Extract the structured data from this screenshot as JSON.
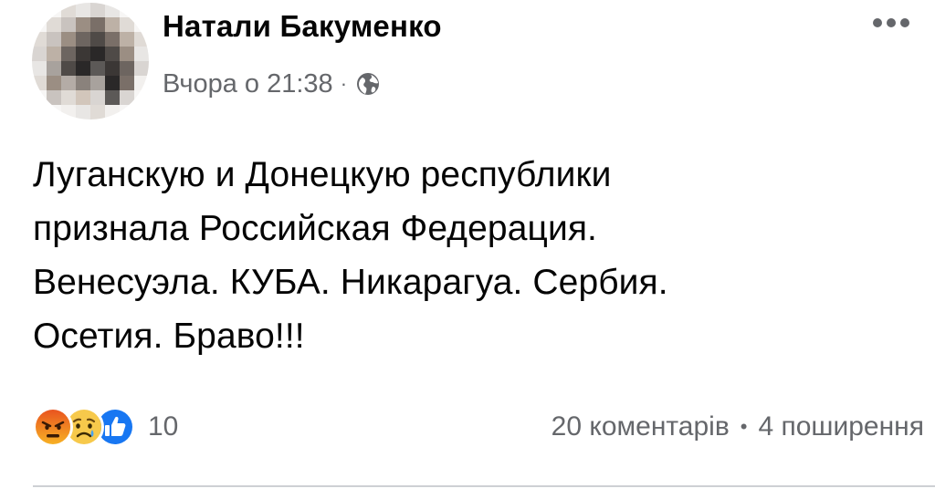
{
  "post": {
    "author": "Натали Бакуменко",
    "timestamp": "Вчора о 21:38",
    "separator": "·",
    "audience_icon": "globe-icon",
    "more_icon": "ellipsis-icon",
    "text_lines": [
      "Луганскую и Донецкую республики",
      "признала Российская Федерация.",
      "Венесуэла. КУБА. Никарагуа. Сербия.",
      "Осетия. Браво!!!"
    ],
    "reactions": {
      "icons": [
        "angry-icon",
        "sad-icon",
        "like-icon"
      ],
      "count": "10"
    },
    "stats": {
      "comments": "20 коментарів",
      "separator": "•",
      "shares": "4 поширення"
    }
  },
  "colors": {
    "text": "#050505",
    "secondary": "#65676b",
    "like_blue": "#1877f2",
    "angry_orange": "#f0702a",
    "sad_yellow": "#f7b125"
  }
}
